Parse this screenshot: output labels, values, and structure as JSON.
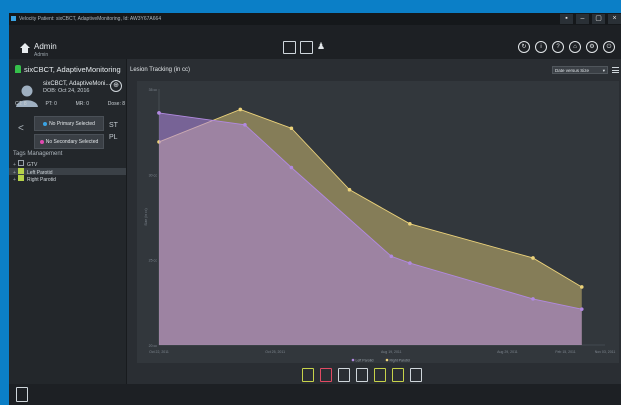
{
  "titlebar": {
    "text": "Velocity Patient: sixCBCT, AdaptiveMonitoring, Id: AW3Y67A664"
  },
  "topbar": {
    "user": "Admin",
    "role": "Admin"
  },
  "patient": {
    "header_name": "sixCBCT, AdaptiveMonitoring",
    "card_name": "sixCBCT, AdaptiveMoni...",
    "dob": "DOB: Oct 24, 2016",
    "ct": "CT: 8",
    "pt": "PT: 0",
    "mr": "MR: 0",
    "dose": "Dose: 8"
  },
  "selection": {
    "primary": "No Primary Selected",
    "secondary": "No Secondary Selected",
    "st_label": "ST",
    "pl_label": "PL"
  },
  "tags": {
    "header": "Tags Management",
    "items": [
      "GTV",
      "Left Parotid",
      "Right Parotid"
    ]
  },
  "main": {
    "title": "Lesion Tracking (in cc)",
    "dropdown": "Date versus Size"
  },
  "colors": {
    "left_parotid": "#b189e0",
    "right_parotid": "#ecd27a",
    "accent": "#0b7fc7"
  },
  "chart_data": {
    "type": "area",
    "xlabel": "",
    "ylabel": "Size (in cc)",
    "x_ticks": [
      "Oct 22, 2011",
      "Oct 25, 2011",
      "Aug 19, 2011",
      "Aug 29, 2011",
      "Feb 15, 2011",
      "Nov 03, 2011"
    ],
    "y_ticks": [
      "35 cc",
      "30 cc",
      "25 cc",
      "20 cc"
    ],
    "series": [
      {
        "name": "Left Parotid",
        "points": [
          [
            0.0,
            33.6
          ],
          [
            0.0,
            33.6
          ],
          [
            0.37,
            32.9
          ],
          [
            0.57,
            30.4
          ],
          [
            1.0,
            25.2
          ],
          [
            1.08,
            24.8
          ],
          [
            1.61,
            22.7
          ],
          [
            1.82,
            22.1
          ]
        ]
      },
      {
        "name": "Right Parotid",
        "points": [
          [
            0.0,
            31.9
          ],
          [
            0.35,
            33.8
          ],
          [
            0.57,
            32.7
          ],
          [
            0.82,
            29.1
          ],
          [
            1.08,
            27.1
          ],
          [
            1.61,
            25.1
          ],
          [
            1.82,
            23.4
          ]
        ]
      }
    ],
    "legend": [
      "Left Parotid",
      "Right Parotid"
    ]
  }
}
